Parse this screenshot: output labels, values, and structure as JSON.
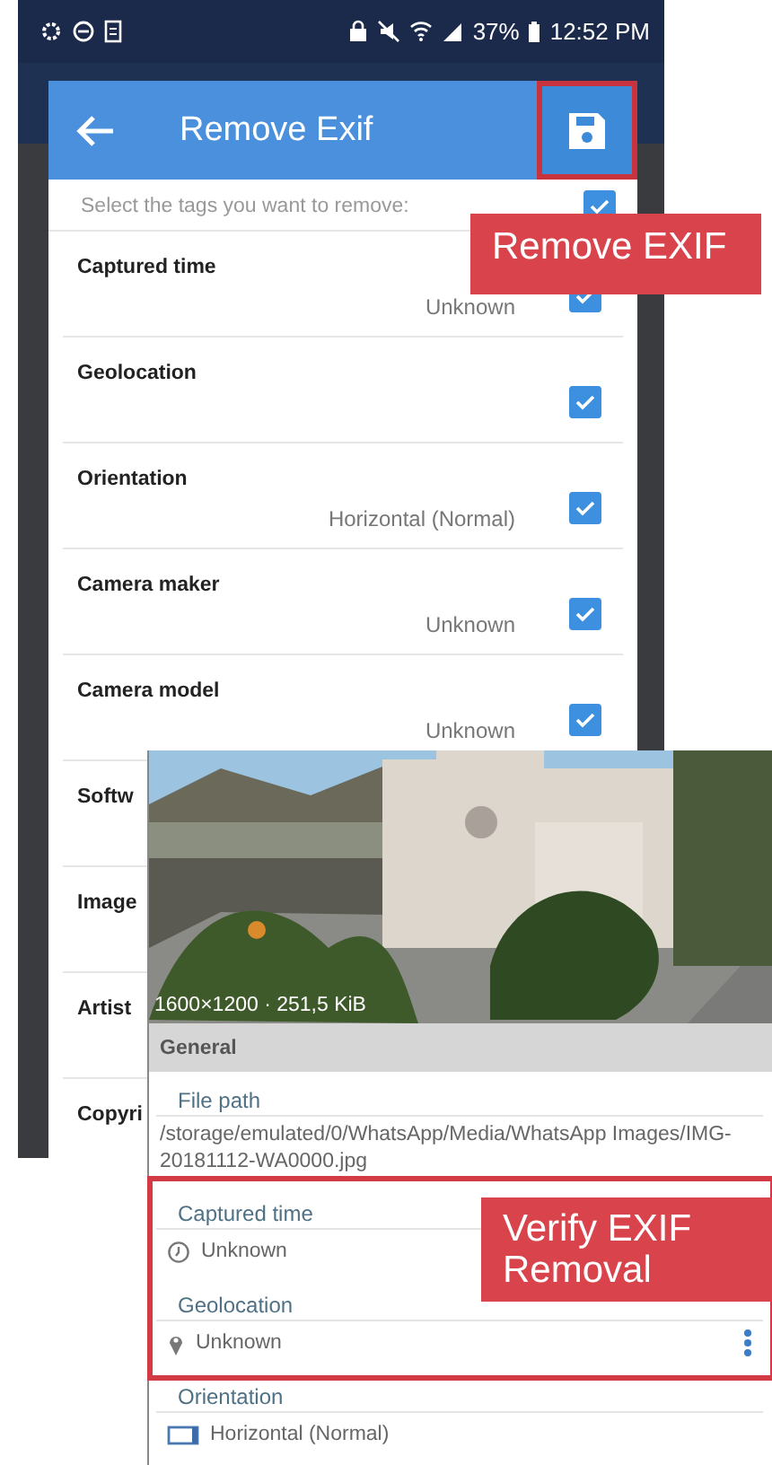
{
  "status_bar": {
    "battery": "37%",
    "time": "12:52 PM"
  },
  "remove_dialog": {
    "title": "Remove Exif",
    "instruction": "Select the tags you want to remove:",
    "select_all_checked": true,
    "save_highlighted": true,
    "tags": [
      {
        "name": "Captured time",
        "value": "Unknown",
        "checked": true
      },
      {
        "name": "Geolocation",
        "checked": true
      },
      {
        "name": "Orientation",
        "value": "Horizontal (Normal)",
        "checked": true
      },
      {
        "name": "Camera maker",
        "value": "Unknown",
        "checked": true
      },
      {
        "name": "Camera model",
        "value": "Unknown",
        "checked": true
      },
      {
        "name": "Softw"
      },
      {
        "name": "Image"
      },
      {
        "name": "Artist"
      },
      {
        "name": "Copyri"
      }
    ]
  },
  "details": {
    "photo_caption": "1600×1200 · 251,5 KiB",
    "section": "General",
    "fields": [
      {
        "kind": "path",
        "label": "File path",
        "value": "/storage/emulated/0/WhatsApp/Media/WhatsApp Images/IMG-20181112-WA0000.jpg"
      },
      {
        "kind": "time",
        "label": "Captured time",
        "value": "Unknown",
        "highlighted": true
      },
      {
        "kind": "location",
        "label": "Geolocation",
        "value": "Unknown",
        "highlighted": true,
        "has_menu": true
      },
      {
        "kind": "orientation",
        "label": "Orientation",
        "value": "Horizontal (Normal)"
      }
    ]
  },
  "callouts": [
    {
      "text": "Remove EXIF"
    },
    {
      "text": "Verify EXIF Removal"
    }
  ]
}
